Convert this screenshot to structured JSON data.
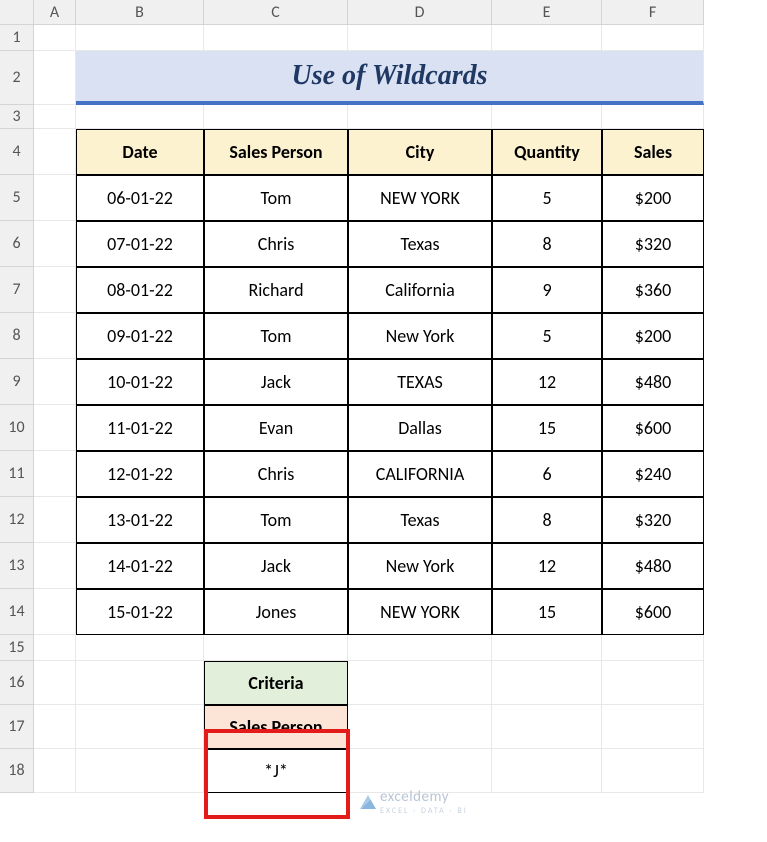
{
  "columns": [
    "A",
    "B",
    "C",
    "D",
    "E",
    "F"
  ],
  "rows": [
    "1",
    "2",
    "3",
    "4",
    "5",
    "6",
    "7",
    "8",
    "9",
    "10",
    "11",
    "12",
    "13",
    "14",
    "15",
    "16",
    "17",
    "18"
  ],
  "title": "Use of Wildcards",
  "table": {
    "headers": [
      "Date",
      "Sales Person",
      "City",
      "Quantity",
      "Sales"
    ],
    "rows": [
      {
        "date": "06-01-22",
        "person": "Tom",
        "city": "NEW YORK",
        "qty": "5",
        "sales": "$200"
      },
      {
        "date": "07-01-22",
        "person": "Chris",
        "city": "Texas",
        "qty": "8",
        "sales": "$320"
      },
      {
        "date": "08-01-22",
        "person": "Richard",
        "city": "California",
        "qty": "9",
        "sales": "$360"
      },
      {
        "date": "09-01-22",
        "person": "Tom",
        "city": "New York",
        "qty": "5",
        "sales": "$200"
      },
      {
        "date": "10-01-22",
        "person": "Jack",
        "city": "TEXAS",
        "qty": "12",
        "sales": "$480"
      },
      {
        "date": "11-01-22",
        "person": "Evan",
        "city": "Dallas",
        "qty": "15",
        "sales": "$600"
      },
      {
        "date": "12-01-22",
        "person": "Chris",
        "city": "CALIFORNIA",
        "qty": "6",
        "sales": "$240"
      },
      {
        "date": "13-01-22",
        "person": "Tom",
        "city": "Texas",
        "qty": "8",
        "sales": "$320"
      },
      {
        "date": "14-01-22",
        "person": "Jack",
        "city": "New York",
        "qty": "12",
        "sales": "$480"
      },
      {
        "date": "15-01-22",
        "person": "Jones",
        "city": "NEW YORK",
        "qty": "15",
        "sales": "$600"
      }
    ]
  },
  "criteria": {
    "title": "Criteria",
    "header": "Sales Person",
    "value": "*J*"
  },
  "watermark": {
    "text": "exceldemy",
    "sub": "EXCEL · DATA · BI"
  }
}
